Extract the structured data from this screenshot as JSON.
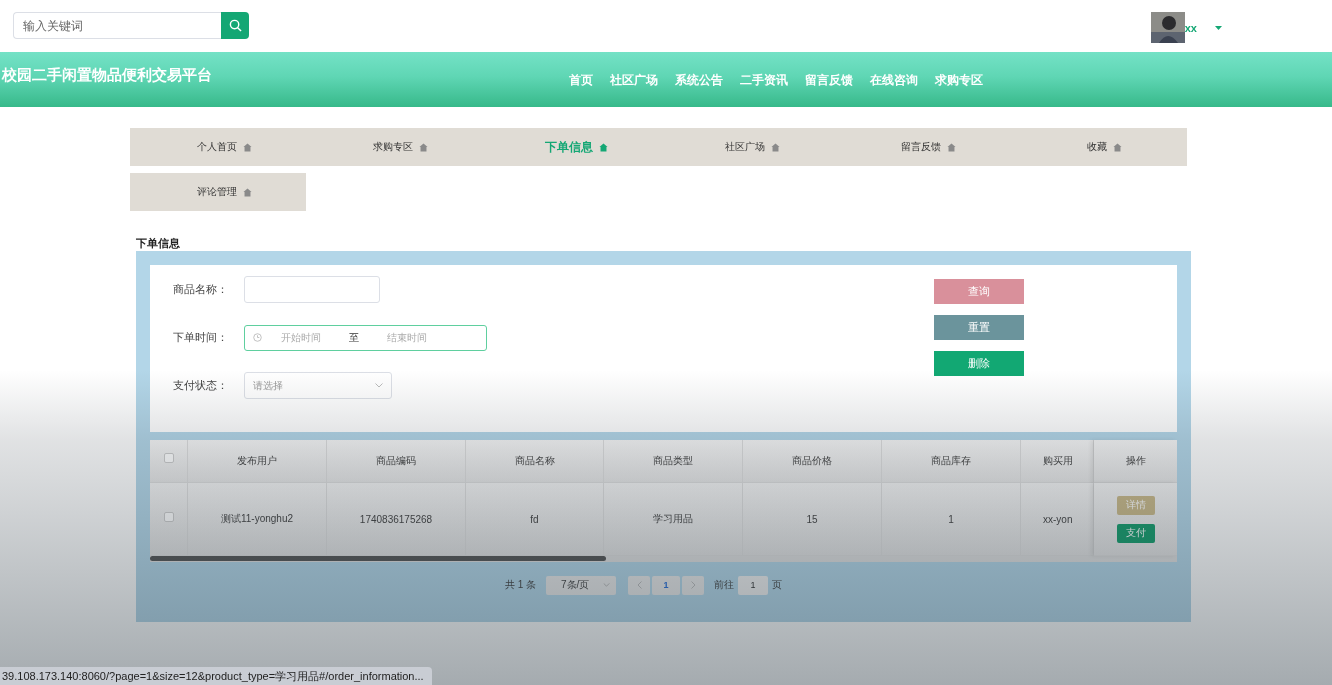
{
  "search": {
    "placeholder": "输入关键词"
  },
  "user": {
    "name": "xx"
  },
  "header": {
    "title": "校园二手闲置物品便利交易平台",
    "nav": [
      {
        "label": "首页"
      },
      {
        "label": "社区广场"
      },
      {
        "label": "系统公告"
      },
      {
        "label": "二手资讯"
      },
      {
        "label": "留言反馈"
      },
      {
        "label": "在线咨询"
      },
      {
        "label": "求购专区"
      }
    ]
  },
  "menu": [
    {
      "label": "个人首页",
      "selected": false
    },
    {
      "label": "求购专区",
      "selected": false
    },
    {
      "label": "下单信息",
      "selected": true
    },
    {
      "label": "社区广场",
      "selected": false
    },
    {
      "label": "留言反馈",
      "selected": false
    },
    {
      "label": "收藏",
      "selected": false
    },
    {
      "label": "评论管理",
      "selected": false
    }
  ],
  "section_title": "下单信息",
  "form": {
    "fields": [
      {
        "kind": "text",
        "label": "商品名称："
      },
      {
        "kind": "daterange",
        "label": "下单时间：",
        "start_placeholder": "开始时间",
        "separator": "至",
        "end_placeholder": "结束时间",
        "focused": true
      },
      {
        "kind": "select",
        "label": "支付状态：",
        "placeholder": "请选择"
      }
    ],
    "buttons": [
      {
        "label": "查询",
        "color": "#d9909b"
      },
      {
        "label": "重置",
        "color": "#6b949c"
      },
      {
        "label": "删除",
        "color": "#12a873"
      }
    ]
  },
  "table": {
    "select_all": {
      "checked": false
    },
    "columns": [
      "发布用户",
      "商品编码",
      "商品名称",
      "商品类型",
      "商品价格",
      "商品库存",
      "购买用"
    ],
    "action_column": "操作",
    "rows": [
      {
        "checked": false,
        "cells": [
          "测试11-yonghu2",
          "1740836175268",
          "fd",
          "学习用品",
          "15",
          "1",
          "xx-yon"
        ],
        "actions": [
          {
            "label": "详情",
            "kind": "detail"
          },
          {
            "label": "支付",
            "kind": "pay"
          }
        ]
      }
    ]
  },
  "pagination": {
    "total": "共 1 条",
    "page_size": "7条/页",
    "pages": [
      {
        "label": "1",
        "selected": true
      }
    ],
    "goto_label": "前往",
    "goto_value": "1",
    "goto_suffix": "页"
  },
  "status_url": "39.108.173.140:8060/?page=1&size=12&product_type=学习用品#/order_information..."
}
